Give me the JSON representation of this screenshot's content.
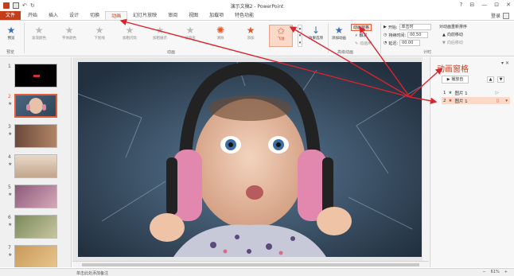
{
  "window": {
    "title": "演示文稿2 - PowerPoint",
    "qat_undo": "↶",
    "qat_redo": "↻",
    "win_buttons": [
      "?",
      "⊟",
      "—",
      "⊡",
      "✕"
    ]
  },
  "tabs": [
    "文件",
    "开始",
    "插入",
    "设计",
    "切换",
    "动画",
    "幻灯片放映",
    "审阅",
    "视图",
    "加载项",
    "特色功能"
  ],
  "active_tab": "动画",
  "login": "登录",
  "ribbon": {
    "preview_label": "预览",
    "preview_group": "预览",
    "animation_group": "动画",
    "animations": [
      "波浪颜色",
      "字体颜色",
      "下划线",
      "加粗闪烁",
      "加粗展示",
      "波浪形",
      "清除",
      "添加",
      "飞溢"
    ],
    "effect_options": "效果选项",
    "add_animation": "添加动画",
    "anim_pane_btn": "动画窗格",
    "trigger": "触发",
    "anim_painter": "动画刷",
    "advanced_group": "高级动画",
    "start_label": "开始:",
    "start_value": "单击时",
    "duration_label": "持续时间:",
    "duration_value": "00.50",
    "delay_label": "延迟:",
    "delay_value": "00.00",
    "reorder_title": "对动画重新排序",
    "move_earlier": "向前移动",
    "move_later": "向后移动",
    "timing_group": "计时"
  },
  "thumbnails": [
    "1",
    "2",
    "3",
    "4",
    "5",
    "6",
    "7"
  ],
  "selected_thumbnail": 2,
  "anim_pane": {
    "title": "动画窗格",
    "play_button": "播放自",
    "items": [
      {
        "num": "1",
        "name": "图片 1"
      },
      {
        "num": "2",
        "name": "图片 1"
      }
    ]
  },
  "statusbar": {
    "notes_placeholder": "单击此处添加备注",
    "zoom": "61%"
  },
  "colors": {
    "accent": "#c43e1c",
    "highlight": "#fbd9c9",
    "arrow": "#d9232e"
  }
}
